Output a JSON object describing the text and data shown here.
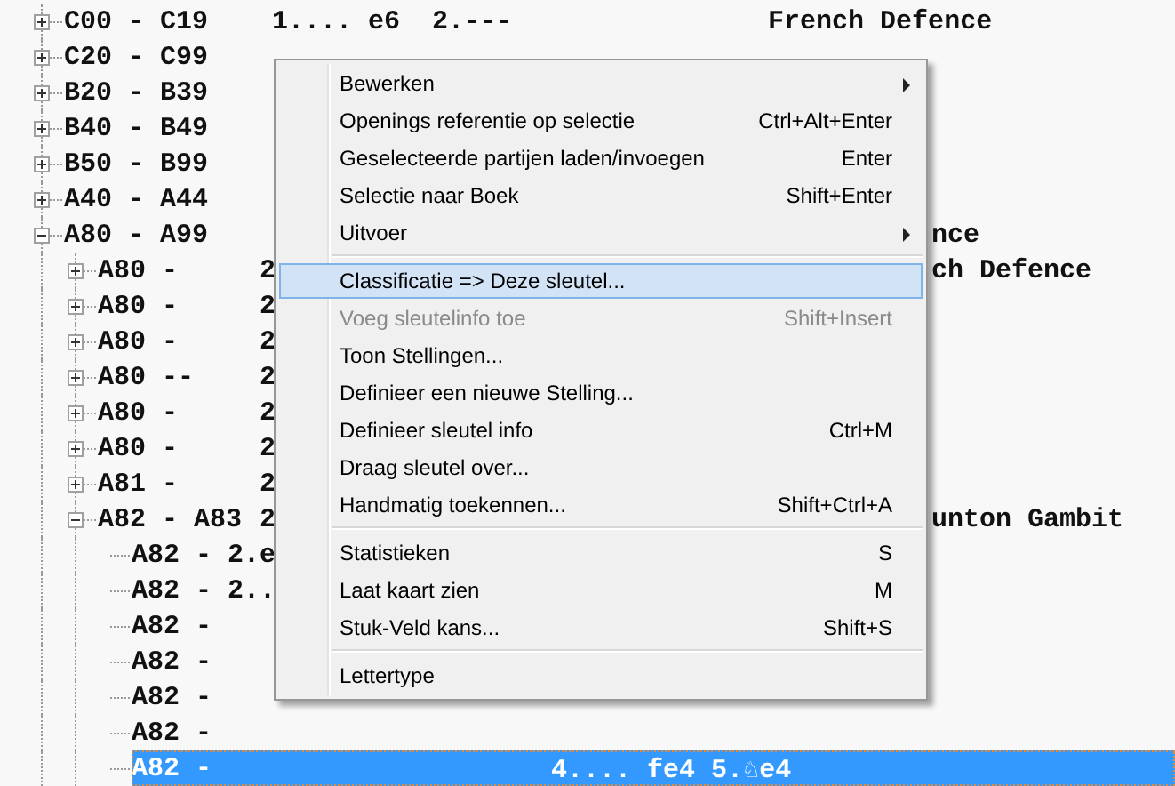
{
  "tree": [
    {
      "label": "C00 - C19",
      "moves": "1.... e6  2.---",
      "name": "French Defence",
      "expanded": false,
      "selected": false
    },
    {
      "label": "C20 - C99",
      "expanded": false,
      "selected": false
    },
    {
      "label": "B20 - B39",
      "expanded": false,
      "selected": false
    },
    {
      "label": "B40 - B49",
      "expanded": false,
      "selected": false
    },
    {
      "label": "B50 - B99",
      "expanded": false,
      "selected": false
    },
    {
      "label": "A40 - A44",
      "expanded": false,
      "selected": false
    },
    {
      "label": "A80 - A99",
      "name": "nce",
      "name_clipped": true,
      "expanded": true,
      "selected": false,
      "children": [
        {
          "label": "A80 -",
          "moves": "2",
          "name": "ch Defence",
          "name_clipped": true,
          "expanded": false,
          "selected": false
        },
        {
          "label": "A80 -",
          "moves": "2",
          "expanded": false,
          "selected": false
        },
        {
          "label": "A80 -",
          "moves": "2",
          "expanded": false,
          "selected": false
        },
        {
          "label": "A80 --",
          "moves": "2",
          "expanded": false,
          "selected": false
        },
        {
          "label": "A80 -",
          "moves": "2",
          "expanded": false,
          "selected": false
        },
        {
          "label": "A80 -",
          "moves": "2",
          "expanded": false,
          "selected": false
        },
        {
          "label": "A81 -",
          "moves": "2",
          "expanded": false,
          "selected": false
        },
        {
          "label": "A82 - A83",
          "moves": "2",
          "name": "unton Gambit",
          "name_clipped": true,
          "expanded": true,
          "selected": false,
          "children": [
            {
              "label": "A82 - 2.e",
              "selected": false
            },
            {
              "label": "A82 - 2..",
              "selected": false
            },
            {
              "label": "A82 -",
              "selected": false
            },
            {
              "label": "A82 -",
              "selected": false
            },
            {
              "label": "A82 -",
              "selected": false
            },
            {
              "label": "A82 -",
              "selected": false
            },
            {
              "label": "A82 -",
              "moves": "4.... fe4 5.♘e4",
              "selected": true
            }
          ]
        }
      ]
    }
  ],
  "context_menu": [
    {
      "kind": "item",
      "label": "Bewerken",
      "submenu": true,
      "disabled": false,
      "selected": false
    },
    {
      "kind": "item",
      "label": "Openings referentie op selectie",
      "shortcut": "Ctrl+Alt+Enter",
      "submenu": false,
      "disabled": false,
      "selected": false
    },
    {
      "kind": "item",
      "label": "Geselecteerde partijen laden/invoegen",
      "shortcut": "Enter",
      "submenu": false,
      "disabled": false,
      "selected": false
    },
    {
      "kind": "item",
      "label": "Selectie naar Boek",
      "shortcut": "Shift+Enter",
      "submenu": false,
      "disabled": false,
      "selected": false
    },
    {
      "kind": "item",
      "label": "Uitvoer",
      "submenu": true,
      "disabled": false,
      "selected": false
    },
    {
      "kind": "separator"
    },
    {
      "kind": "item",
      "label": "Classificatie => Deze sleutel...",
      "submenu": false,
      "disabled": false,
      "selected": true
    },
    {
      "kind": "item",
      "label": "Voeg sleutelinfo toe",
      "shortcut": "Shift+Insert",
      "submenu": false,
      "disabled": true,
      "selected": false
    },
    {
      "kind": "item",
      "label": "Toon Stellingen...",
      "submenu": false,
      "disabled": false,
      "selected": false
    },
    {
      "kind": "item",
      "label": "Definieer een nieuwe Stelling...",
      "submenu": false,
      "disabled": false,
      "selected": false
    },
    {
      "kind": "item",
      "label": "Definieer sleutel info",
      "shortcut": "Ctrl+M",
      "submenu": false,
      "disabled": false,
      "selected": false
    },
    {
      "kind": "item",
      "label": "Draag sleutel over...",
      "submenu": false,
      "disabled": false,
      "selected": false
    },
    {
      "kind": "item",
      "label": "Handmatig toekennen...",
      "shortcut": "Shift+Ctrl+A",
      "submenu": false,
      "disabled": false,
      "selected": false
    },
    {
      "kind": "separator"
    },
    {
      "kind": "item",
      "label": "Statistieken",
      "shortcut": "S",
      "submenu": false,
      "disabled": false,
      "selected": false
    },
    {
      "kind": "item",
      "label": "Laat kaart zien",
      "shortcut": "M",
      "submenu": false,
      "disabled": false,
      "selected": false
    },
    {
      "kind": "item",
      "label": "Stuk-Veld kans...",
      "shortcut": "Shift+S",
      "submenu": false,
      "disabled": false,
      "selected": false
    },
    {
      "kind": "separator"
    },
    {
      "kind": "item",
      "label": "Lettertype",
      "submenu": false,
      "disabled": false,
      "selected": false
    }
  ]
}
